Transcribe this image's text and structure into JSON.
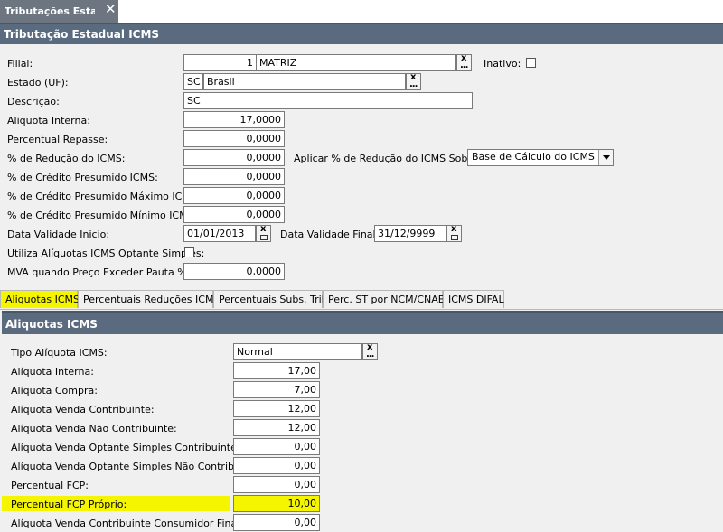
{
  "window_tab": {
    "title": "Tributações Esta...",
    "close": "✕"
  },
  "main_header": "Tributação Estadual ICMS",
  "form": {
    "filial_label": "Filial:",
    "filial_code": "1",
    "filial_name": "MATRIZ",
    "inativo_label": "Inativo:",
    "estado_label": "Estado (UF):",
    "estado_uf": "SC",
    "estado_name": "Brasil",
    "descricao_label": "Descrição:",
    "descricao_value": "SC",
    "aliquota_interna_label": "Aliquota Interna:",
    "aliquota_interna_value": "17,0000",
    "percentual_repasse_label": "Percentual Repasse:",
    "percentual_repasse_value": "0,0000",
    "reducao_icms_label": "% de Redução do ICMS:",
    "reducao_icms_value": "0,0000",
    "aplicar_reducao_label": "Aplicar % de Redução do ICMS Sobre:",
    "aplicar_reducao_value": "Base de Cálculo do ICMS",
    "credito_presumido_label": "% de Crédito Presumido ICMS:",
    "credito_presumido_value": "0,0000",
    "credito_presumido_max_label": "% de Crédito Presumido Máximo ICMS:",
    "credito_presumido_max_value": "0,0000",
    "credito_presumido_min_label": "% de Crédito Presumido Mínimo ICMS:",
    "credito_presumido_min_value": "0,0000",
    "data_inicio_label": "Data Validade Inicio:",
    "data_inicio_value": "01/01/2013",
    "data_final_label": "Data Validade Final:",
    "data_final_value": "31/12/9999",
    "utiliza_simples_label": "Utiliza Alíquotas ICMS Optante Simples:",
    "mva_label": "MVA quando Preço Exceder Pauta %:",
    "mva_value": "0,0000"
  },
  "tabs": [
    {
      "label": "Aliquotas ICMS"
    },
    {
      "label": "Percentuais Reduções ICMS"
    },
    {
      "label": "Percentuais Subs. Trib."
    },
    {
      "label": "Perc. ST por NCM/CNAE"
    },
    {
      "label": "ICMS DIFAL"
    }
  ],
  "aliquotas_header": "Aliquotas ICMS",
  "aliquotas": {
    "tipo_label": "Tipo Alíquota ICMS:",
    "tipo_value": "Normal",
    "rows": [
      {
        "label": "Alíquota Interna:",
        "value": "17,00"
      },
      {
        "label": "Alíquota Compra:",
        "value": "7,00"
      },
      {
        "label": "Alíquota Venda Contribuinte:",
        "value": "12,00"
      },
      {
        "label": "Alíquota Venda Não Contribuinte:",
        "value": "12,00"
      },
      {
        "label": "Alíquota Venda Optante Simples Contribuinte:",
        "value": "0,00"
      },
      {
        "label": "Alíquota Venda Optante Simples Não Contribuinte:",
        "value": "0,00"
      },
      {
        "label": "Percentual FCP:",
        "value": "0,00"
      },
      {
        "label": "Percentual FCP Próprio:",
        "value": "10,00"
      },
      {
        "label": "Alíquota Venda Contribuinte Consumidor Final:",
        "value": "0,00"
      }
    ]
  },
  "colors": {
    "header_bg": "#5b6b7f",
    "highlight": "#f5f500",
    "doc_tab_bg": "#6d7580"
  },
  "icons": {
    "lookup": "ellipsis-lookup-icon",
    "clear": "clear-x-icon",
    "calendar": "calendar-icon"
  }
}
